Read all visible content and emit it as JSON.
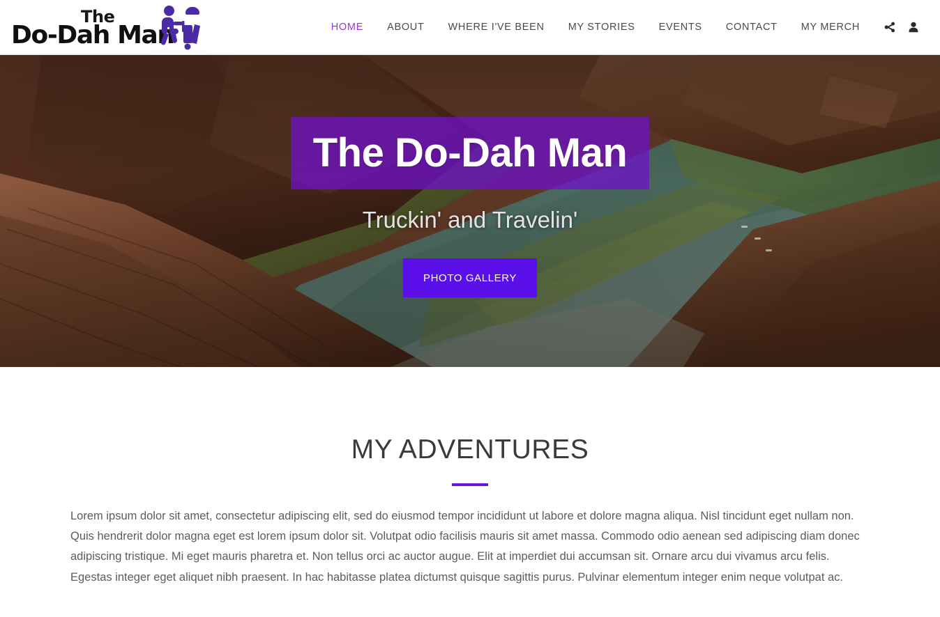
{
  "header": {
    "logo": {
      "the_text": "The",
      "name_text": "Do-Dah Man",
      "mark_icon": "traveler-with-luggage-icon",
      "mark_color": "#4B2AA8"
    },
    "nav": {
      "items": [
        {
          "label": "HOME",
          "active": true
        },
        {
          "label": "ABOUT",
          "active": false
        },
        {
          "label": "WHERE I'VE BEEN",
          "active": false
        },
        {
          "label": "MY STORIES",
          "active": false
        },
        {
          "label": "EVENTS",
          "active": false
        },
        {
          "label": "CONTACT",
          "active": false
        },
        {
          "label": "MY MERCH",
          "active": false
        }
      ],
      "active_color": "#9B30E8",
      "inactive_color": "#4A4A4A",
      "icons": [
        {
          "name": "share-icon"
        },
        {
          "name": "user-account-icon"
        }
      ]
    }
  },
  "hero": {
    "background_image": "horseshoe-bend-canyon-river-aerial-photo",
    "title": "The Do-Dah Man",
    "title_band_color": "#6E10CC",
    "subtitle": "Truckin' and Travelin'",
    "cta_label": "PHOTO GALLERY",
    "cta_color": "#5B0FE8"
  },
  "adventures": {
    "heading": "MY ADVENTURES",
    "rule_color": "#6B10E0",
    "body": "Lorem ipsum dolor sit amet, consectetur adipiscing elit, sed do eiusmod tempor incididunt ut labore et dolore magna aliqua. Nisl tincidunt eget nullam non. Quis hendrerit dolor magna eget est lorem ipsum dolor sit. Volutpat odio facilisis mauris sit amet massa. Commodo odio aenean sed adipiscing diam donec adipiscing tristique. Mi eget mauris pharetra et. Non tellus orci ac auctor augue. Elit at imperdiet dui accumsan sit. Ornare arcu dui vivamus arcu felis. Egestas integer eget aliquet nibh praesent. In hac habitasse platea dictumst quisque sagittis purus. Pulvinar elementum integer enim neque volutpat ac."
  }
}
